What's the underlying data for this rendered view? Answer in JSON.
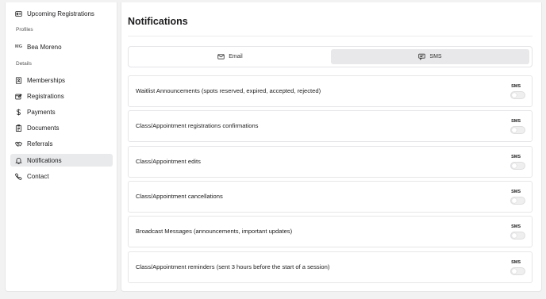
{
  "sidebar": {
    "upcoming_registrations": "Upcoming Registrations",
    "profiles_label": "Profiles",
    "profile": {
      "initials": "MG",
      "name": "Bea Moreno"
    },
    "details_label": "Details",
    "items": [
      {
        "label": "Memberships",
        "icon": "id-card-icon"
      },
      {
        "label": "Registrations",
        "icon": "register-icon"
      },
      {
        "label": "Payments",
        "icon": "dollar-icon"
      },
      {
        "label": "Documents",
        "icon": "clipboard-icon"
      },
      {
        "label": "Referrals",
        "icon": "handshake-icon"
      },
      {
        "label": "Notifications",
        "icon": "bell-icon",
        "active": true
      },
      {
        "label": "Contact",
        "icon": "phone-icon"
      }
    ]
  },
  "main": {
    "title": "Notifications",
    "tabs": [
      {
        "label": "Email",
        "icon": "mail-icon",
        "active": false
      },
      {
        "label": "SMS",
        "icon": "message-icon",
        "active": true
      }
    ],
    "notifications": [
      {
        "label": "Waitlist Announcements (spots reserved, expired, accepted, rejected)",
        "channel": "SMS",
        "enabled": false
      },
      {
        "label": "Class/Appointment registrations confirmations",
        "channel": "SMS",
        "enabled": false
      },
      {
        "label": "Class/Appointment edits",
        "channel": "SMS",
        "enabled": false
      },
      {
        "label": "Class/Appointment cancellations",
        "channel": "SMS",
        "enabled": false
      },
      {
        "label": "Broadcast Messages (announcements, important updates)",
        "channel": "SMS",
        "enabled": false
      },
      {
        "label": "Class/Appointment reminders (sent 3 hours before the start of a session)",
        "channel": "SMS",
        "enabled": false
      }
    ]
  },
  "colors": {
    "page_bg": "#f2f2f3",
    "active_bg": "#e9eaec",
    "toggle_off": "#efefef"
  }
}
